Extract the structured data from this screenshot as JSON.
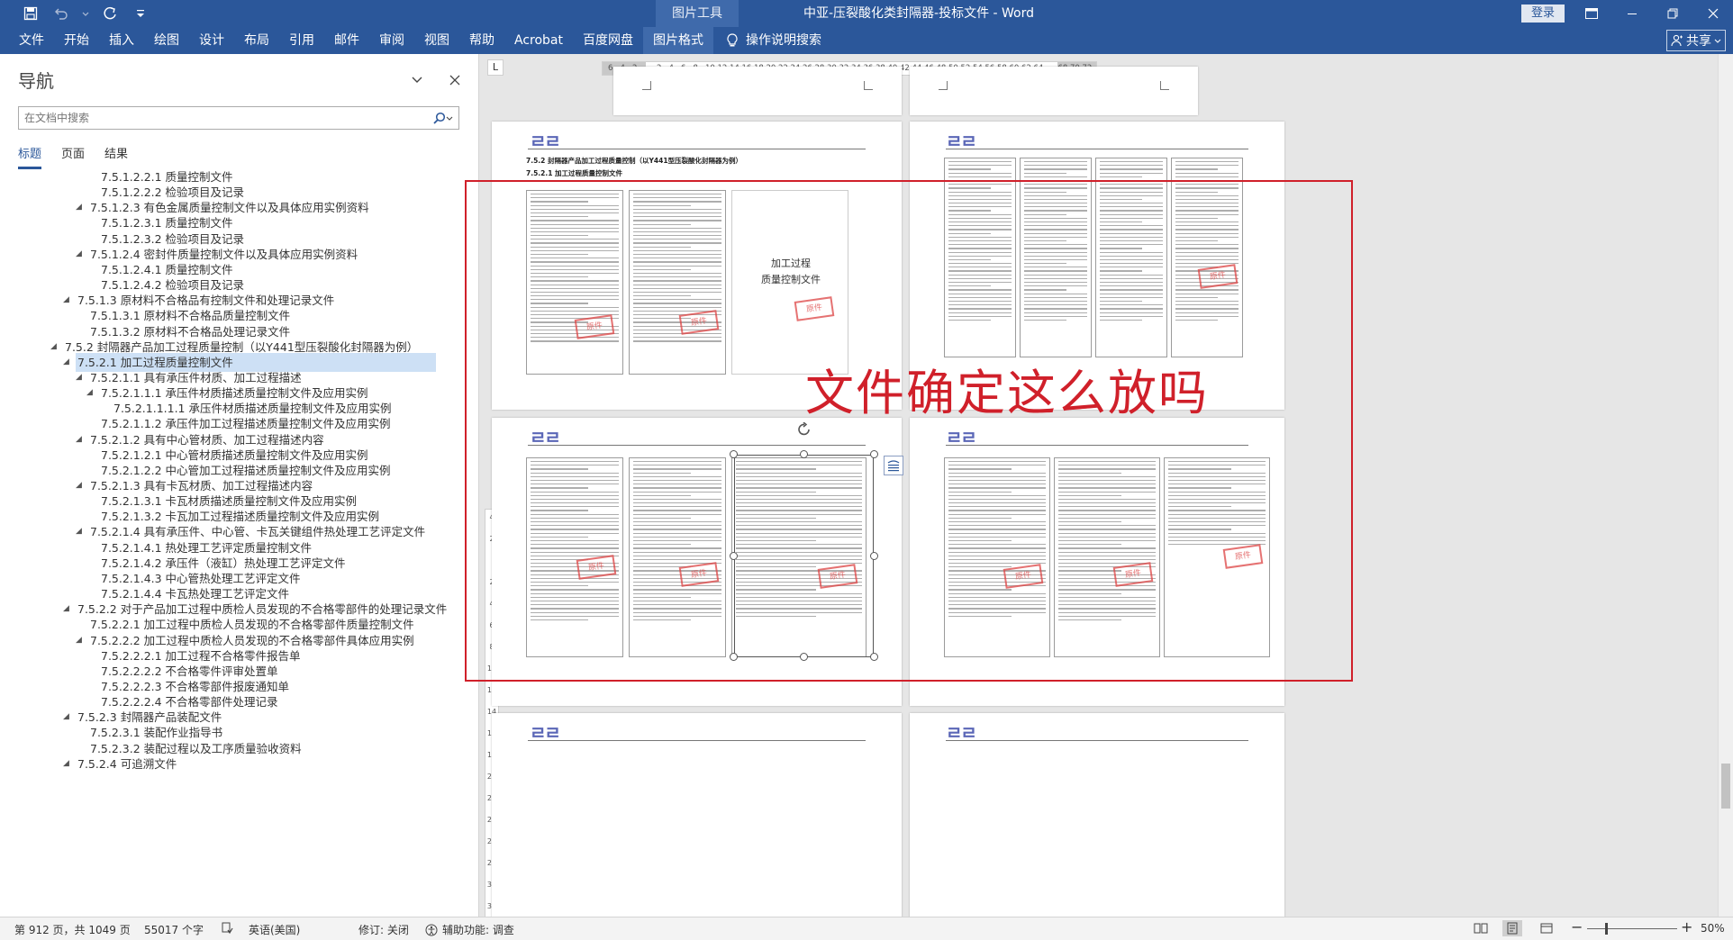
{
  "titlebar": {
    "context_tools": "图片工具",
    "document_title": "中亚-压裂酸化类封隔器-投标文件  -  Word",
    "login": "登录"
  },
  "ribbon": {
    "tabs": [
      "文件",
      "开始",
      "插入",
      "绘图",
      "设计",
      "布局",
      "引用",
      "邮件",
      "审阅",
      "视图",
      "帮助",
      "Acrobat",
      "百度网盘",
      "图片格式"
    ],
    "tell_me": "操作说明搜索",
    "share": "共享"
  },
  "nav": {
    "title": "导航",
    "search_placeholder": "在文档中搜索",
    "tabs": [
      "标题",
      "页面",
      "结果"
    ],
    "headings": [
      {
        "text": "7.5.1.2.2.1 质量控制文件",
        "level": 5,
        "expanded": null
      },
      {
        "text": "7.5.1.2.2.2 检验项目及记录",
        "level": 5,
        "expanded": null
      },
      {
        "text": "7.5.1.2.3 有色金属质量控制文件以及具体应用实例资料",
        "level": 4,
        "expanded": true
      },
      {
        "text": "7.5.1.2.3.1 质量控制文件",
        "level": 5,
        "expanded": null
      },
      {
        "text": "7.5.1.2.3.2 检验项目及记录",
        "level": 5,
        "expanded": null
      },
      {
        "text": "7.5.1.2.4 密封件质量控制文件以及具体应用实例资料",
        "level": 4,
        "expanded": true
      },
      {
        "text": "7.5.1.2.4.1 质量控制文件",
        "level": 5,
        "expanded": null
      },
      {
        "text": "7.5.1.2.4.2 检验项目及记录",
        "level": 5,
        "expanded": null
      },
      {
        "text": "7.5.1.3 原材料不合格品有控制文件和处理记录文件",
        "level": 3,
        "expanded": true
      },
      {
        "text": "7.5.1.3.1 原材料不合格品质量控制文件",
        "level": 4,
        "expanded": null
      },
      {
        "text": "7.5.1.3.2 原材料不合格品处理记录文件",
        "level": 4,
        "expanded": null
      },
      {
        "text": "7.5.2 封隔器产品加工过程质量控制（以Y441型压裂酸化封隔器为例）",
        "level": 2,
        "expanded": true
      },
      {
        "text": "7.5.2.1 加工过程质量控制文件",
        "level": 3,
        "expanded": true,
        "selected": true
      },
      {
        "text": "7.5.2.1.1 具有承压件材质、加工过程描述",
        "level": 4,
        "expanded": true
      },
      {
        "text": "7.5.2.1.1.1 承压件材质描述质量控制文件及应用实例",
        "level": 5,
        "expanded": true
      },
      {
        "text": "7.5.2.1.1.1.1 承压件材质描述质量控制文件及应用实例",
        "level": 6,
        "expanded": null
      },
      {
        "text": "7.5.2.1.1.2 承压件加工过程描述质量控制文件及应用实例",
        "level": 5,
        "expanded": null
      },
      {
        "text": "7.5.2.1.2 具有中心管材质、加工过程描述内容",
        "level": 4,
        "expanded": true
      },
      {
        "text": "7.5.2.1.2.1 中心管材质描述质量控制文件及应用实例",
        "level": 5,
        "expanded": null
      },
      {
        "text": "7.5.2.1.2.2 中心管加工过程描述质量控制文件及应用实例",
        "level": 5,
        "expanded": null
      },
      {
        "text": "7.5.2.1.3 具有卡瓦材质、加工过程描述内容",
        "level": 4,
        "expanded": true
      },
      {
        "text": "7.5.2.1.3.1 卡瓦材质描述质量控制文件及应用实例",
        "level": 5,
        "expanded": null
      },
      {
        "text": "7.5.2.1.3.2 卡瓦加工过程描述质量控制文件及应用实例",
        "level": 5,
        "expanded": null
      },
      {
        "text": "7.5.2.1.4 具有承压件、中心管、卡瓦关键组件热处理工艺评定文件",
        "level": 4,
        "expanded": true
      },
      {
        "text": "7.5.2.1.4.1 热处理工艺评定质量控制文件",
        "level": 5,
        "expanded": null
      },
      {
        "text": "7.5.2.1.4.2 承压件（液缸）热处理工艺评定文件",
        "level": 5,
        "expanded": null
      },
      {
        "text": "7.5.2.1.4.3 中心管热处理工艺评定文件",
        "level": 5,
        "expanded": null
      },
      {
        "text": "7.5.2.1.4.4 卡瓦热处理工艺评定文件",
        "level": 5,
        "expanded": null
      },
      {
        "text": "7.5.2.2 对于产品加工过程中质检人员发现的不合格零部件的处理记录文件",
        "level": 3,
        "expanded": true
      },
      {
        "text": "7.5.2.2.1 加工过程中质检人员发现的不合格零部件质量控制文件",
        "level": 4,
        "expanded": null
      },
      {
        "text": "7.5.2.2.2 加工过程中质检人员发现的不合格零部件具体应用实例",
        "level": 4,
        "expanded": true
      },
      {
        "text": "7.5.2.2.2.1 加工过程不合格零件报告单",
        "level": 5,
        "expanded": null
      },
      {
        "text": "7.5.2.2.2.2 不合格零件评审处置单",
        "level": 5,
        "expanded": null
      },
      {
        "text": "7.5.2.2.2.3 不合格零部件报废通知单",
        "level": 5,
        "expanded": null
      },
      {
        "text": "7.5.2.2.2.4 不合格零部件处理记录",
        "level": 5,
        "expanded": null
      },
      {
        "text": "7.5.2.3 封隔器产品装配文件",
        "level": 3,
        "expanded": true
      },
      {
        "text": "7.5.2.3.1 装配作业指导书",
        "level": 4,
        "expanded": null
      },
      {
        "text": "7.5.2.3.2 装配过程以及工序质量验收资料",
        "level": 4,
        "expanded": null
      },
      {
        "text": "7.5.2.4 可追溯文件",
        "level": 3,
        "expanded": true
      }
    ]
  },
  "document": {
    "ruler_corner": "L",
    "hruler_ticks": [
      "6",
      "4",
      "2",
      "",
      "2",
      "4",
      "6",
      "8",
      "10",
      "12",
      "14",
      "16",
      "18",
      "20",
      "22",
      "24",
      "26",
      "28",
      "30",
      "32",
      "34",
      "36",
      "38",
      "40",
      "42",
      "44",
      "46",
      "48",
      "50",
      "52",
      "54",
      "56",
      "58",
      "60",
      "62",
      "64",
      "",
      "68",
      "70",
      "72"
    ],
    "vruler_ticks": [
      "4",
      "2",
      "",
      "2",
      "4",
      "6",
      "8",
      "10",
      "12",
      "14",
      "16",
      "18",
      "20",
      "22",
      "24",
      "26",
      "28",
      "30",
      "32"
    ],
    "section_heading": "7.5.2 封隔器产品加工过程质量控制（以Y441型压裂酸化封隔器为例）",
    "sub_heading": "7.5.2.1 加工过程质量控制文件",
    "cover_title_1": "加工过程",
    "cover_title_2": "质量控制文件",
    "stamp_text": "原件",
    "annotation": "文件确定这么放吗",
    "annotation_color": "#d0202a"
  },
  "status": {
    "page": "第 912 页，共 1049 页",
    "words": "55017 个字",
    "language": "英语(美国)",
    "track_changes": "修订: 关闭",
    "accessibility": "辅助功能: 调查",
    "zoom": "50%"
  },
  "colors": {
    "brand": "#2b579a",
    "context_tab": "#3f6aab",
    "selection": "#cde0f5"
  }
}
